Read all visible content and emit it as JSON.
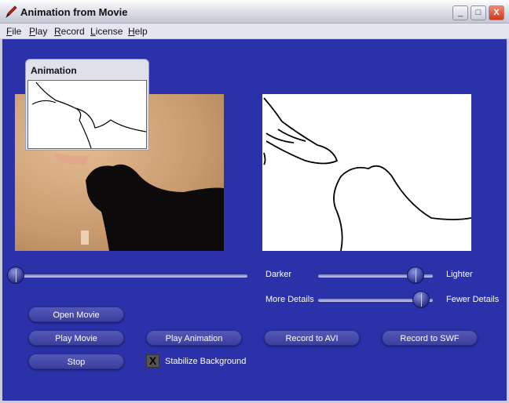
{
  "window": {
    "title": "Animation from Movie",
    "minimize": "_",
    "maximize": "□",
    "close": "X"
  },
  "menu": [
    "File",
    "Play",
    "Record",
    "License",
    "Help"
  ],
  "popup": {
    "title": "Animation"
  },
  "sliders": {
    "position": {
      "value": 0
    },
    "brightness": {
      "left_label": "Darker",
      "right_label": "Lighter",
      "value": 0.85
    },
    "detail": {
      "left_label": "More Details",
      "right_label": "Fewer Details",
      "value": 0.9
    }
  },
  "buttons": {
    "open_movie": "Open Movie",
    "play_movie": "Play Movie",
    "play_animation": "Play Animation",
    "record_avi": "Record to AVI",
    "record_swf": "Record to SWF",
    "stop": "Stop"
  },
  "stabilize": {
    "label": "Stabilize Background",
    "checked": true,
    "mark": "X"
  },
  "colors": {
    "background": "#2b31a8"
  }
}
